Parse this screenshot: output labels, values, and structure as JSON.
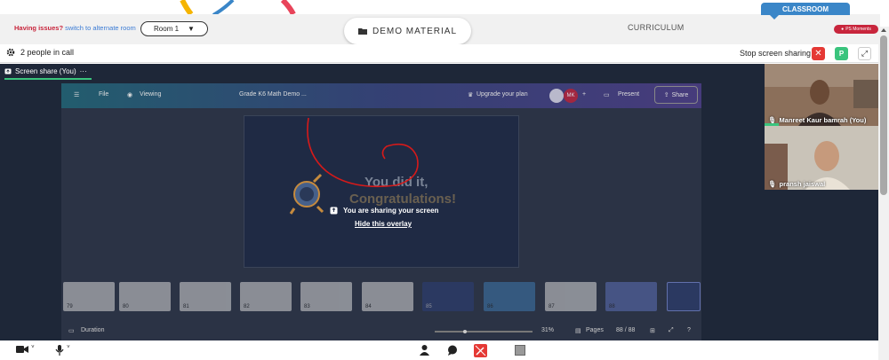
{
  "topbar": {
    "issues_label": "Having issues?",
    "alternate_room_link": "switch to alternate room",
    "room_value": "Room 1",
    "demo_material_label": "DEMO MATERIAL",
    "curriculum_label": "CURRICULUM",
    "classroom_label": "CLASSROOM",
    "ps_moments_label": "PS Moments"
  },
  "callbar": {
    "people_count": "2 people in call",
    "stop_sharing_label": "Stop screen sharing",
    "stop_button": "✕",
    "p_button": "P",
    "expand_button": "⤢"
  },
  "stage": {
    "screen_share_tab": "Screen share (You)",
    "more": "···"
  },
  "shared_screen": {
    "toolbar": {
      "file": "File",
      "viewing": "Viewing",
      "doc_title": "Grade K6 Math Demo ...",
      "upgrade": "Upgrade your plan",
      "avatar_initials": "MK",
      "plus": "+",
      "present": "Present",
      "share": "Share"
    },
    "slide": {
      "line1": "You did it,",
      "line2": "Congratulations!"
    },
    "overlay": {
      "sharing_text": "You are sharing your screen",
      "hide_link": "Hide this overlay"
    },
    "thumbnails": [
      "79",
      "80",
      "81",
      "82",
      "83",
      "84",
      "85",
      "86",
      "87",
      "88"
    ],
    "bottom": {
      "duration": "Duration",
      "zoom": "31%",
      "pages_label": "Pages",
      "pages_count": "88 / 88"
    }
  },
  "participants": [
    {
      "name": "Manreet Kaur bamrah (You)"
    },
    {
      "name": "pransh jaiswal"
    }
  ],
  "colors": {
    "accent_green": "#3ac47d",
    "danger_red": "#e53935",
    "classroom_blue": "#3a86c8",
    "stage_bg": "#1e2738"
  }
}
